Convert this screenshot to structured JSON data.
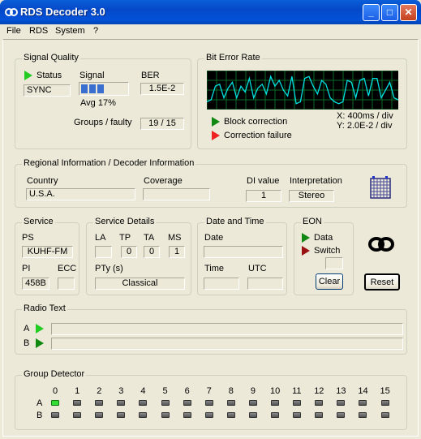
{
  "window": {
    "title": "RDS Decoder 3.0",
    "icon": "rds-logo-icon",
    "buttons": [
      "minimize",
      "maximize",
      "close"
    ]
  },
  "menu": [
    "File",
    "RDS",
    "System",
    "?"
  ],
  "signal_quality": {
    "title": "Signal Quality",
    "status_label": "Status",
    "status_value": "SYNC",
    "signal_label": "Signal",
    "signal_level_bars": 3,
    "signal_total_bars": 6,
    "avg_label": "Avg",
    "avg_value": "17%",
    "ber_label": "BER",
    "ber_value": "1.5E-2",
    "groups_label": "Groups / faulty",
    "groups_value": "19 / 15"
  },
  "ber": {
    "title": "Bit Error Rate",
    "block_correction": "Block correction",
    "correction_failure": "Correction failure",
    "x_scale": "X: 400ms / div",
    "y_scale": "Y: 2.0E-2 / div",
    "trace": [
      0.2,
      0.25,
      0.6,
      0.65,
      0.3,
      0.55,
      0.7,
      0.3,
      0.6,
      0.45,
      0.8,
      0.3,
      0.55,
      0.65,
      0.4,
      0.85,
      0.6,
      0.75,
      0.5,
      0.35,
      0.85,
      0.15,
      0.2,
      0.8,
      0.85,
      0.6,
      0.4,
      0.75,
      0.65,
      0.3,
      0.2,
      0.15,
      0.2,
      0.75,
      0.7,
      0.3,
      0.75,
      0.8,
      0.35,
      0.8,
      0.8,
      0.3,
      0.5,
      0.7,
      0.3,
      0.25
    ]
  },
  "regional": {
    "title": "Regional Information / Decoder Information",
    "country_label": "Country",
    "country_value": "U.S.A.",
    "coverage_label": "Coverage",
    "coverage_value": "",
    "di_label": "DI value",
    "di_value": "1",
    "interp_label": "Interpretation",
    "interp_value": "Stereo"
  },
  "service": {
    "title": "Service",
    "ps_label": "PS",
    "ps_value": "KUHF-FM",
    "pi_label": "PI",
    "pi_value": "458B",
    "ecc_label": "ECC",
    "ecc_value": ""
  },
  "service_details": {
    "title": "Service Details",
    "la_label": "LA",
    "la_value": "",
    "tp_label": "TP",
    "tp_value": "0",
    "ta_label": "TA",
    "ta_value": "0",
    "ms_label": "MS",
    "ms_value": "1",
    "pty_label": "PTy (s)",
    "pty_value": "Classical"
  },
  "datetime": {
    "title": "Date and Time",
    "date_label": "Date",
    "date_value": "",
    "time_label": "Time",
    "time_value": "",
    "utc_label": "UTC",
    "utc_value": ""
  },
  "eon": {
    "title": "EON",
    "data_label": "Data",
    "switch_label": "Switch",
    "value": "",
    "clear_label": "Clear"
  },
  "reset_label": "Reset",
  "radio_text": {
    "title": "Radio Text",
    "a_label": "A",
    "a_value": "",
    "b_label": "B",
    "b_value": ""
  },
  "group_detector": {
    "title": "Group Detector",
    "row_labels": [
      "A",
      "B"
    ],
    "columns": [
      "0",
      "1",
      "2",
      "3",
      "4",
      "5",
      "6",
      "7",
      "8",
      "9",
      "10",
      "11",
      "12",
      "13",
      "14",
      "15"
    ],
    "active": [
      {
        "row": "A",
        "col": "0"
      }
    ]
  }
}
